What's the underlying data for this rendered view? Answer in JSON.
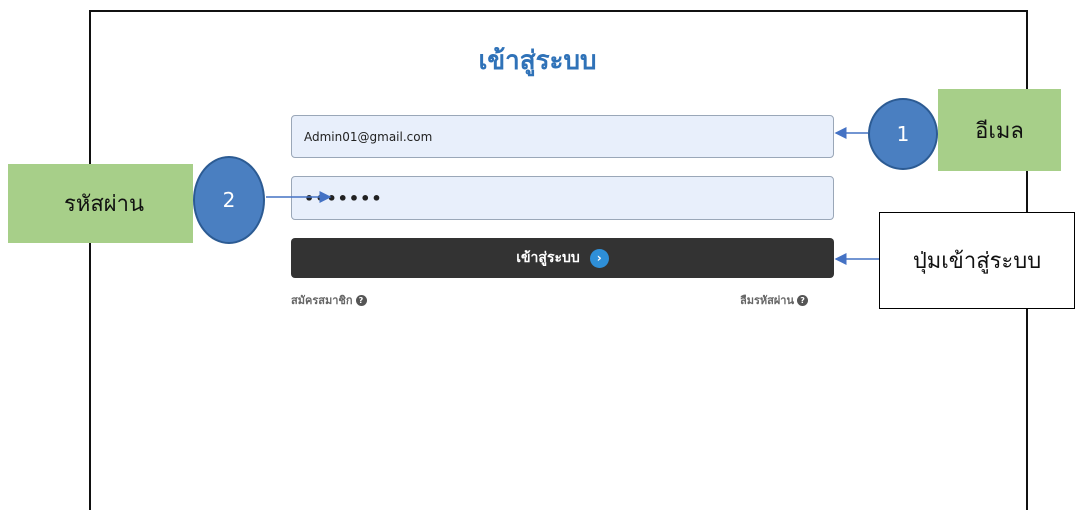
{
  "page": {
    "title": "เข้าสู่ระบบ"
  },
  "form": {
    "email_value": "Admin01@gmail.com",
    "password_value": "•••••••",
    "login_label": "เข้าสู่ระบบ",
    "register_label": "สมัครสมาชิก",
    "forgot_label": "ลืมรหัสผ่าน"
  },
  "annotations": {
    "email_label": "อีเมล",
    "email_number": "1",
    "password_label": "รหัสผ่าน",
    "password_number": "2",
    "login_button_label": "ปุ่มเข้าสู่ระบบ"
  },
  "colors": {
    "title": "#2f72b8",
    "input_bg": "#e8effb",
    "button_bg": "#333333",
    "callout_green": "#a7cf89",
    "callout_circle": "#4a7fc1",
    "arrow": "#4472c4"
  },
  "icons": {
    "login_arrow": "chevron-right-circle-icon",
    "help": "question-circle-icon"
  }
}
